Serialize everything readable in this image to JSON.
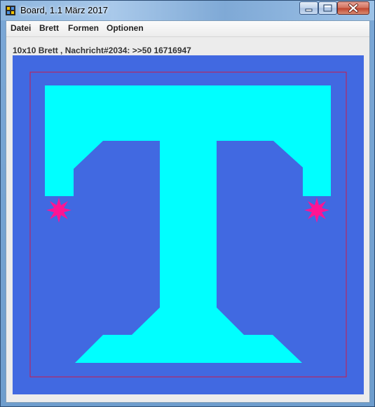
{
  "window": {
    "title": "Board, 1.1 März 2017",
    "controls": [
      "minimize",
      "maximize",
      "close"
    ]
  },
  "menu": {
    "items": [
      {
        "label": "Datei"
      },
      {
        "label": "Brett"
      },
      {
        "label": "Formen"
      },
      {
        "label": "Optionen"
      }
    ]
  },
  "status": {
    "text": "10x10 Brett , Nachricht#2034: >>50 16716947"
  },
  "colors": {
    "board_background": "#4169e1",
    "shape_fill": "#00ffff",
    "border_line": "#cc1a4a",
    "marker": "#ff1493"
  },
  "icons": {
    "app": "board-app-icon",
    "markers": "star-marker-icon"
  }
}
